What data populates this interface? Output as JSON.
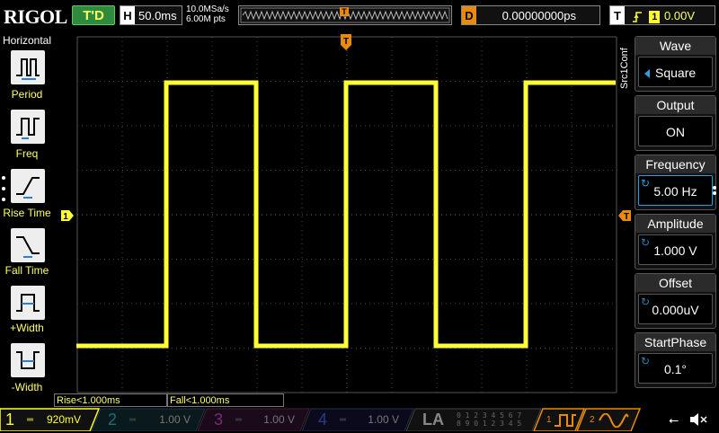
{
  "topbar": {
    "logo": "RIGOL",
    "run_status": "T'D",
    "timebase_tag": "H",
    "timebase": "50.0ms",
    "sample_rate": "10.0MSa/s",
    "memory_depth": "6.00M pts",
    "trigger_marker": "T",
    "delay_tag": "D",
    "delay_value": "0.00000000ps",
    "trigger_tag": "T",
    "trigger_channel": "1",
    "trigger_level": "0.00V"
  },
  "left_menu": {
    "title": "Horizontal",
    "items": [
      {
        "label": "Period"
      },
      {
        "label": "Freq"
      },
      {
        "label": "Rise Time"
      },
      {
        "label": "Fall Time"
      },
      {
        "label": "+Width"
      },
      {
        "label": "-Width"
      }
    ]
  },
  "grid": {
    "ch1_marker": "1",
    "trigger_top_marker": "T",
    "trigger_level_marker": "T"
  },
  "right_menu": {
    "source_tab": "Src1Conf",
    "panels": [
      {
        "title": "Wave",
        "value": "Square"
      },
      {
        "title": "Output",
        "value": "ON"
      },
      {
        "title": "Frequency",
        "value": "5.00 Hz"
      },
      {
        "title": "Amplitude",
        "value": "1.000 V"
      },
      {
        "title": "Offset",
        "value": "0.000uV"
      },
      {
        "title": "StartPhase",
        "value": "0.1°"
      }
    ]
  },
  "measurements": {
    "rise": "Rise<1.000ms",
    "fall": "Fall<1.000ms"
  },
  "channels": [
    {
      "num": "1",
      "value": "920mV",
      "color": "#ffff33"
    },
    {
      "num": "2",
      "value": "1.00 V",
      "color": "#00e5ff"
    },
    {
      "num": "3",
      "value": "1.00 V",
      "color": "#ff33ff"
    },
    {
      "num": "4",
      "value": "1.00 V",
      "color": "#3366ff"
    }
  ],
  "bottom": {
    "la_label": "LA",
    "la_bits_top": "0 1 2 3  4 5 6 7",
    "la_bits_bottom": "8 9 0 1  2 3 4 5",
    "src1_num": "1",
    "src2_num": "2"
  },
  "colors": {
    "ch1": "#ffff33",
    "accent_orange": "#e88a10",
    "run_green": "#2e8b3e"
  }
}
